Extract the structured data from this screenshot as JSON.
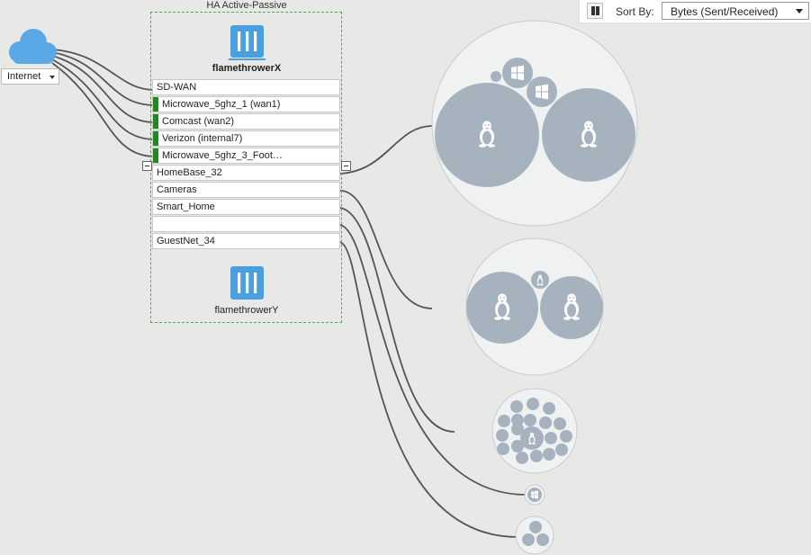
{
  "toolbar": {
    "sort_label": "Sort By:",
    "sort_value": "Bytes (Sent/Received)"
  },
  "internet": {
    "label": "Internet",
    "icon": "cloud-icon",
    "color": "#5aa9e6"
  },
  "cluster": {
    "title": "HA Active-Passive",
    "primary": "flamethrowerX",
    "secondary": "flamethrowerY",
    "border_color": "#4caf50",
    "device_icon": "fortigate-icon",
    "device_color": "#4a9fdf"
  },
  "wan_group": "SD-WAN",
  "wan_links": [
    "Microwave_5ghz_1 (wan1)",
    "Comcast (wan2)",
    "Verizon (internal7)",
    "Microwave_5ghz_3_Foot…"
  ],
  "link_status_color": "#1f8a1f",
  "lan_interfaces": [
    "HomeBase_32",
    "Cameras",
    "Smart_Home",
    "",
    "GuestNet_34"
  ],
  "blurred_interface_text": "",
  "host_groups_icons": [
    "linux-icon",
    "windows-icon"
  ],
  "bubble_colors": {
    "outer": "#f0f2f2",
    "inner": "#a6b3bf"
  }
}
